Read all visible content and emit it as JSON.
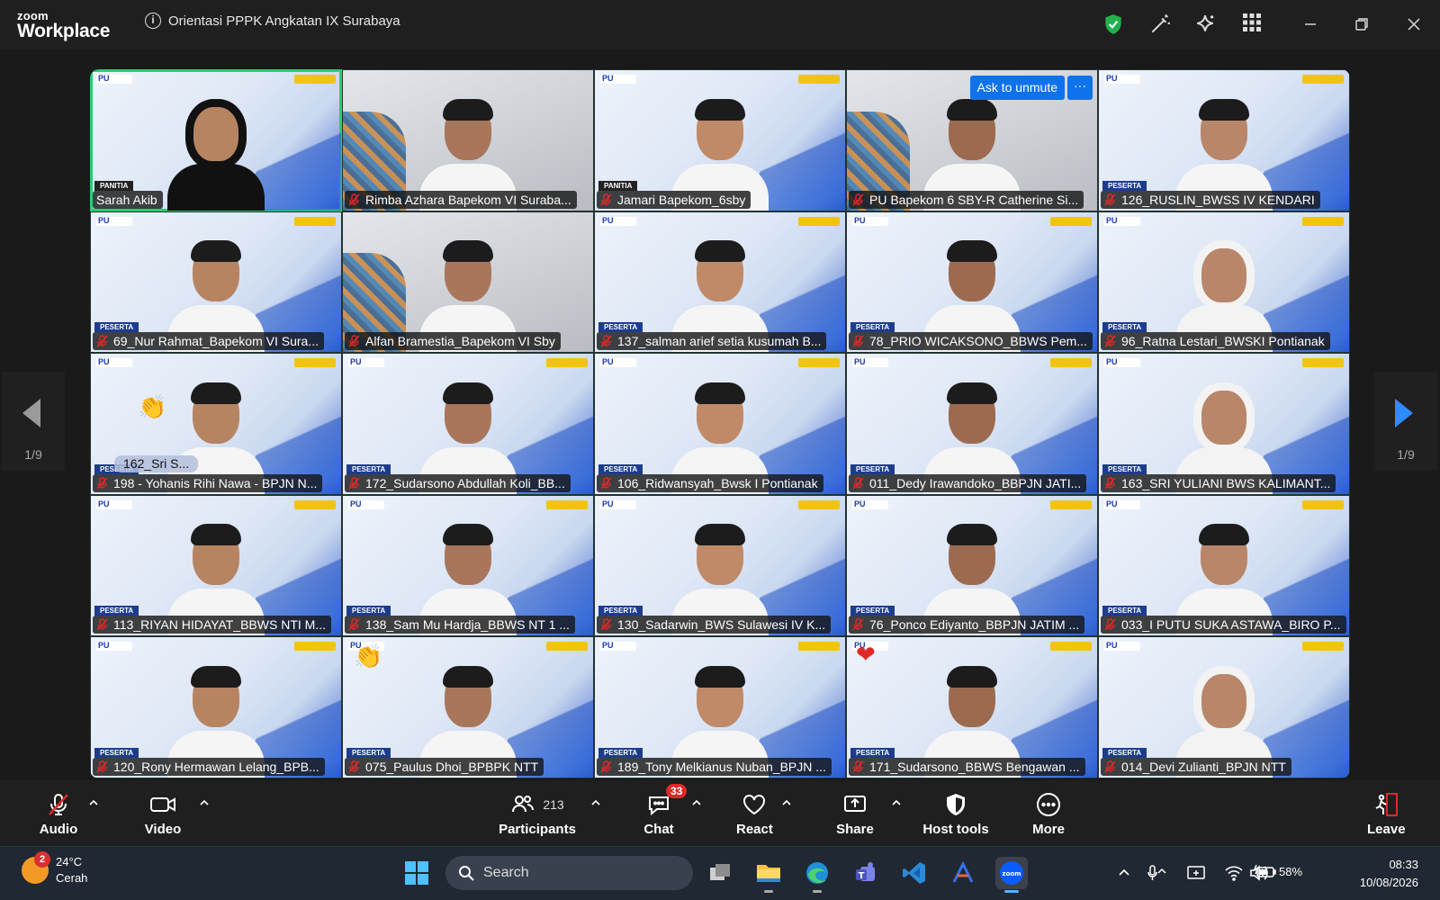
{
  "window": {
    "logo_top": "zoom",
    "logo_bottom": "Workplace",
    "meeting_title": "Orientasi PPPK Angkatan IX Surabaya"
  },
  "tiles": [
    {
      "name": "Sarah Akib",
      "muted": false,
      "role": "PANITIA",
      "person": "hijab-black",
      "bg": "slide",
      "active": true
    },
    {
      "name": "Rimba Azhara Bapekom VI Suraba...",
      "muted": true,
      "role": "",
      "person": "man",
      "bg": "alt"
    },
    {
      "name": "Jamari Bapekom_6sby",
      "muted": true,
      "role": "PANITIA",
      "person": "man",
      "bg": "slide"
    },
    {
      "name": "PU Bapekom 6 SBY-R Catherine Si...",
      "muted": true,
      "role": "",
      "person": "woman",
      "bg": "alt"
    },
    {
      "name": "126_RUSLIN_BWSS IV KENDARI",
      "muted": true,
      "role": "PESERTA",
      "person": "man",
      "bg": "slide"
    },
    {
      "name": "69_Nur Rahmat_Bapekom VI Sura...",
      "muted": true,
      "role": "PESERTA",
      "person": "man",
      "bg": "slide"
    },
    {
      "name": "Alfan Bramestia_Bapekom VI Sby",
      "muted": true,
      "role": "",
      "person": "man",
      "bg": "alt"
    },
    {
      "name": "137_salman arief setia kusumah B...",
      "muted": true,
      "role": "PESERTA",
      "person": "man",
      "bg": "slide"
    },
    {
      "name": "78_PRIO WICAKSONO_BBWS Pem...",
      "muted": true,
      "role": "PESERTA",
      "person": "man",
      "bg": "slide"
    },
    {
      "name": "96_Ratna Lestari_BWSKI Pontianak",
      "muted": true,
      "role": "PESERTA",
      "person": "hijab-white",
      "bg": "slide"
    },
    {
      "name": "198 - Yohanis Rihi Nawa - BPJN N...",
      "muted": true,
      "role": "PESERTA",
      "person": "man",
      "bg": "slide"
    },
    {
      "name": "172_Sudarsono Abdullah Koli_BB...",
      "muted": true,
      "role": "PESERTA",
      "person": "man",
      "bg": "slide"
    },
    {
      "name": "106_Ridwansyah_Bwsk I Pontianak",
      "muted": true,
      "role": "PESERTA",
      "person": "man",
      "bg": "slide"
    },
    {
      "name": "011_Dedy Irawandoko_BBPJN JATI...",
      "muted": true,
      "role": "PESERTA",
      "person": "man",
      "bg": "slide"
    },
    {
      "name": "163_SRI YULIANI BWS KALIMANT...",
      "muted": true,
      "role": "PESERTA",
      "person": "hijab-white",
      "bg": "slide"
    },
    {
      "name": "113_RIYAN HIDAYAT_BBWS NTI M...",
      "muted": true,
      "role": "PESERTA",
      "person": "man",
      "bg": "slide"
    },
    {
      "name": "138_Sam Mu Hardja_BBWS NT 1 ...",
      "muted": true,
      "role": "PESERTA",
      "person": "man",
      "bg": "slide"
    },
    {
      "name": "130_Sadarwin_BWS Sulawesi IV K...",
      "muted": true,
      "role": "PESERTA",
      "person": "man",
      "bg": "slide"
    },
    {
      "name": "76_Ponco Ediyanto_BBPJN JATIM ...",
      "muted": true,
      "role": "PESERTA",
      "person": "man",
      "bg": "slide"
    },
    {
      "name": "033_I PUTU SUKA ASTAWA_BIRO P...",
      "muted": true,
      "role": "PESERTA",
      "person": "man",
      "bg": "slide"
    },
    {
      "name": "120_Rony Hermawan Lelang_BPB...",
      "muted": true,
      "role": "PESERTA",
      "person": "man",
      "bg": "slide"
    },
    {
      "name": "075_Paulus Dhoi_BPBPK NTT",
      "muted": true,
      "role": "PESERTA",
      "person": "man",
      "bg": "slide"
    },
    {
      "name": "189_Tony Melkianus Nuban_BPJN ...",
      "muted": true,
      "role": "PESERTA",
      "person": "man",
      "bg": "slide"
    },
    {
      "name": "171_Sudarsono_BBWS Bengawan ...",
      "muted": true,
      "role": "PESERTA",
      "person": "man",
      "bg": "slide"
    },
    {
      "name": "014_Devi Zulianti_BPJN NTT",
      "muted": true,
      "role": "PESERTA",
      "person": "hijab-white",
      "bg": "slide"
    }
  ],
  "overlays": {
    "ask_unmute": "Ask to unmute",
    "more_dots": "···",
    "sub_label": "162_Sri  S..."
  },
  "pager": {
    "left": "1/9",
    "right": "1/9"
  },
  "toolbar": {
    "audio": "Audio",
    "video": "Video",
    "participants": "Participants",
    "participants_count": "213",
    "chat": "Chat",
    "chat_badge": "33",
    "react": "React",
    "share": "Share",
    "host_tools": "Host tools",
    "more": "More",
    "leave": "Leave"
  },
  "taskbar": {
    "weather_badge": "2",
    "temperature": "24°C",
    "condition": "Cerah",
    "search_placeholder": "Search",
    "battery": "58%",
    "time": "08:33",
    "date": "10/08/2026"
  },
  "colors": {
    "accent_blue": "#0e72ed",
    "active_speaker": "#2ecc71",
    "muted_red": "#e02828"
  }
}
